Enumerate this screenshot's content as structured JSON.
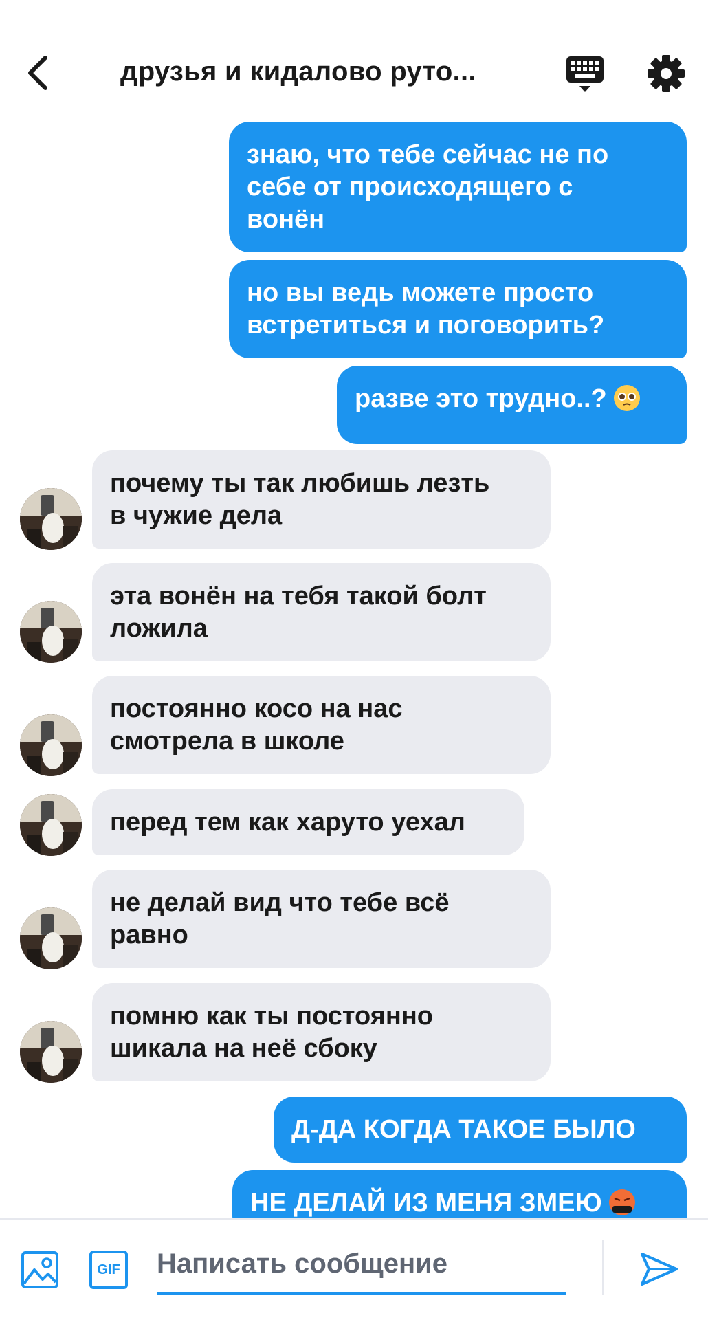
{
  "header": {
    "title": "друзья и кидалово руто...",
    "back_icon": "chevron-left-icon",
    "keyboard_icon": "keyboard-icon",
    "settings_icon": "gear-icon"
  },
  "colors": {
    "outgoing_bubble": "#1c94ef",
    "incoming_bubble": "#eaebf0",
    "accent": "#1c94ef"
  },
  "messages": [
    {
      "side": "out",
      "text": "знаю, что тебе сейчас не по\nсебе от происходящего с\nвонён"
    },
    {
      "side": "out",
      "text": "но вы ведь можете просто\nвстретиться и поговорить?"
    },
    {
      "side": "out",
      "text": "разве это трудно..?",
      "emoji": "pleading-face-icon"
    },
    {
      "side": "in",
      "text": "почему ты так любишь лезть\nв чужие дела"
    },
    {
      "side": "in",
      "text": "эта вонён на тебя такой болт\nложила"
    },
    {
      "side": "in",
      "text": "постоянно косо на нас\nсмотрела в школе"
    },
    {
      "side": "in",
      "text": "перед тем как харуто уехал"
    },
    {
      "side": "in",
      "text": "не делай вид что тебе всё\nравно"
    },
    {
      "side": "in",
      "text": "помню как ты постоянно\nшикала на неё сбоку"
    },
    {
      "side": "out",
      "text": "Д-ДА КОГДА ТАКОЕ БЫЛО"
    },
    {
      "side": "out",
      "text": "НЕ ДЕЛАЙ ИЗ МЕНЯ ЗМЕЮ",
      "emoji": "angry-cursing-face-icon"
    }
  ],
  "composer": {
    "placeholder": "Написать сообщение",
    "gif_label": "GIF",
    "image_icon": "image-icon",
    "send_icon": "send-icon"
  }
}
